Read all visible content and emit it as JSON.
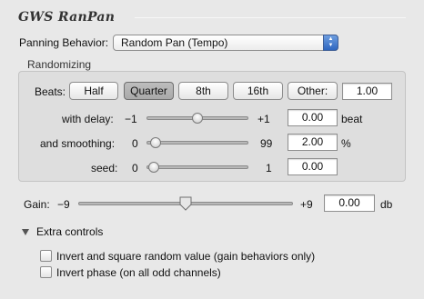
{
  "title": "GWS RanPan",
  "panning": {
    "label": "Panning Behavior:",
    "value": "Random Pan (Tempo)"
  },
  "randomizing": {
    "header": "Randomizing",
    "beats_label": "Beats:",
    "beat_buttons": [
      "Half",
      "Quarter",
      "8th",
      "16th",
      "Other:"
    ],
    "selected_beat": "Quarter",
    "beats_value": "1.00",
    "delay": {
      "label": "with delay:",
      "min": "−1",
      "max": "+1",
      "value": "0.00",
      "unit": "beat",
      "level": 0.5
    },
    "smoothing": {
      "label": "and smoothing:",
      "min": "0",
      "max": "99",
      "value": "2.00",
      "unit": "%",
      "level": 0.02
    },
    "seed": {
      "label": "seed:",
      "min": "0",
      "max": "1",
      "value": "0.00",
      "level": 0.0
    }
  },
  "gain": {
    "label": "Gain:",
    "min": "−9",
    "max": "+9",
    "value": "0.00",
    "unit": "db",
    "level": 0.5
  },
  "extra": {
    "label": "Extra controls",
    "options": [
      {
        "label": "Invert and square random value (gain behaviors only)",
        "checked": false
      },
      {
        "label": "Invert phase (on all odd channels)",
        "checked": false
      }
    ]
  },
  "colors": {
    "background": "#e8e8e8",
    "popup_accent": "#2e66c0"
  }
}
